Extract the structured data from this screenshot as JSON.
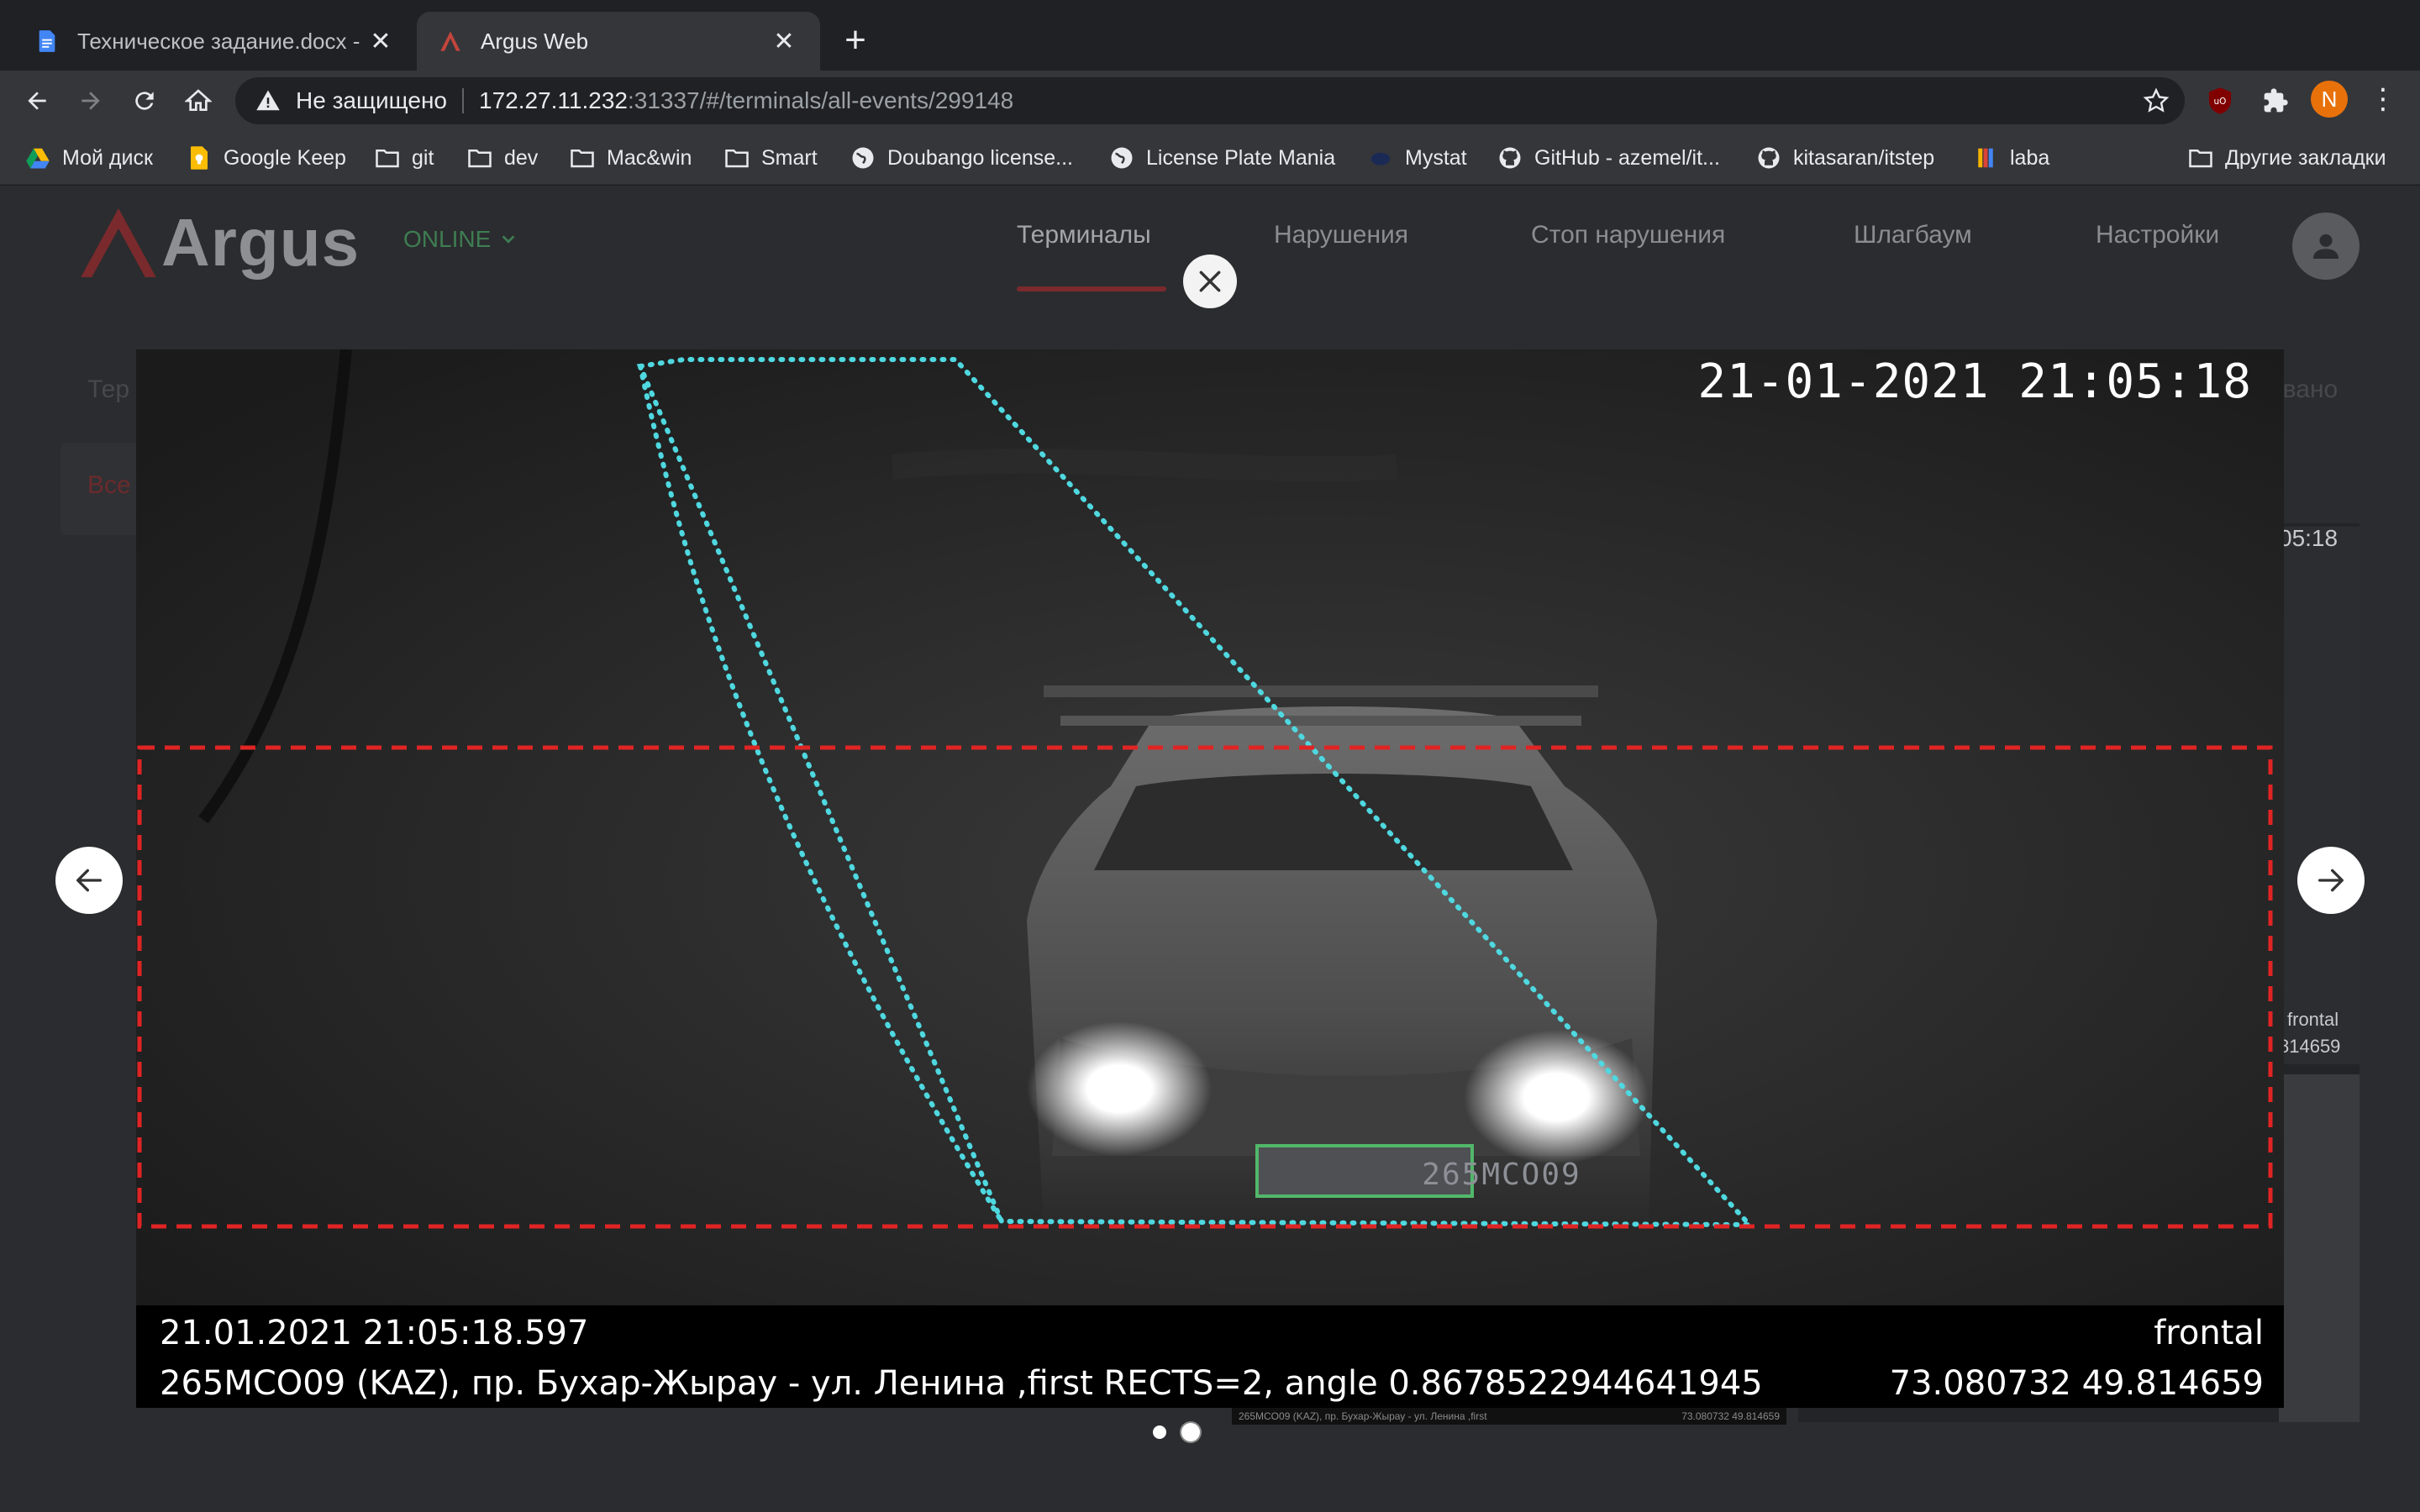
{
  "browser": {
    "tabs": [
      {
        "title": "Техническое задание.docx - Google",
        "icon": "google-docs-icon",
        "close": "✕"
      },
      {
        "title": "Argus Web",
        "icon": "argus-logo-icon",
        "close": "✕"
      }
    ],
    "new_tab": "+",
    "address": {
      "security_label": "Не защищено",
      "host": "172.27.11.232",
      "path": ":31337/#/terminals/all-events/299148"
    },
    "profile_initial": "N",
    "bookmarks": [
      {
        "label": "Мой диск",
        "icon": "google-drive-icon"
      },
      {
        "label": "Google Keep",
        "icon": "google-keep-icon"
      },
      {
        "label": "git",
        "icon": "folder-icon"
      },
      {
        "label": "dev",
        "icon": "folder-icon"
      },
      {
        "label": "Mac&win",
        "icon": "folder-icon"
      },
      {
        "label": "Smart",
        "icon": "folder-icon"
      },
      {
        "label": "Doubango license...",
        "icon": "globe-icon"
      },
      {
        "label": "License Plate Mania",
        "icon": "globe-icon"
      },
      {
        "label": "Mystat",
        "icon": "mystat-icon"
      },
      {
        "label": "GitHub - azemel/it...",
        "icon": "github-icon"
      },
      {
        "label": "kitasaran/itstep",
        "icon": "github-icon"
      },
      {
        "label": "laba",
        "icon": "laba-icon"
      }
    ],
    "other_bookmarks": "Другие закладки"
  },
  "app": {
    "logo_text": "Argus",
    "status": "ONLINE",
    "nav": [
      {
        "label": "Терминалы",
        "active": true
      },
      {
        "label": "Нарушения",
        "active": false
      },
      {
        "label": "Стоп нарушения",
        "active": false
      },
      {
        "label": "Шлагбаум",
        "active": false
      },
      {
        "label": "Настройки",
        "active": false
      }
    ],
    "background_fragments": {
      "breadcrumb_start": "Тер",
      "filter_all": "Все",
      "right_status": "овано",
      "card_time": "05:18",
      "card_type": "frontal",
      "card_coord": "814659"
    }
  },
  "viewer": {
    "camera_timestamp": "21-01-2021 21:05:18",
    "plate_overlay": "265MCO09",
    "caption_timestamp": "21.01.2021 21:05:18.597",
    "caption_type": "frontal",
    "caption_details": "265MCO09 (KAZ), пр. Бухар-Жырау - ул. Ленина ,first RECTS=2, angle 0.8678522944641945",
    "caption_coords": "73.080732 49.814659",
    "under_caption_left": "265MCO09 (KAZ), пр. Бухар-Жырау - ул. Ленина ,first",
    "under_caption_right": "73.080732 49.814659",
    "slides_total": 2,
    "slide_active": 2
  },
  "colors": {
    "detection_zone": "#e02424",
    "lane_zone": "#4fd8e0",
    "plate_box": "#52b86a",
    "status_online": "#3e7d52",
    "active_nav_underline": "#7a2a2c"
  }
}
